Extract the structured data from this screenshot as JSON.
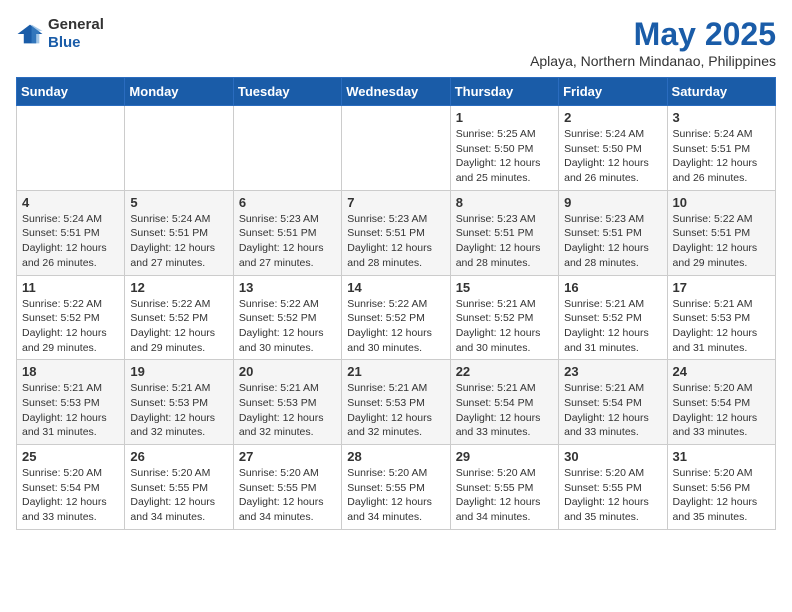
{
  "logo": {
    "general": "General",
    "blue": "Blue"
  },
  "title": "May 2025",
  "subtitle": "Aplaya, Northern Mindanao, Philippines",
  "weekdays": [
    "Sunday",
    "Monday",
    "Tuesday",
    "Wednesday",
    "Thursday",
    "Friday",
    "Saturday"
  ],
  "weeks": [
    [
      {
        "day": "",
        "info": ""
      },
      {
        "day": "",
        "info": ""
      },
      {
        "day": "",
        "info": ""
      },
      {
        "day": "",
        "info": ""
      },
      {
        "day": "1",
        "info": "Sunrise: 5:25 AM\nSunset: 5:50 PM\nDaylight: 12 hours and 25 minutes."
      },
      {
        "day": "2",
        "info": "Sunrise: 5:24 AM\nSunset: 5:50 PM\nDaylight: 12 hours and 26 minutes."
      },
      {
        "day": "3",
        "info": "Sunrise: 5:24 AM\nSunset: 5:51 PM\nDaylight: 12 hours and 26 minutes."
      }
    ],
    [
      {
        "day": "4",
        "info": "Sunrise: 5:24 AM\nSunset: 5:51 PM\nDaylight: 12 hours and 26 minutes."
      },
      {
        "day": "5",
        "info": "Sunrise: 5:24 AM\nSunset: 5:51 PM\nDaylight: 12 hours and 27 minutes."
      },
      {
        "day": "6",
        "info": "Sunrise: 5:23 AM\nSunset: 5:51 PM\nDaylight: 12 hours and 27 minutes."
      },
      {
        "day": "7",
        "info": "Sunrise: 5:23 AM\nSunset: 5:51 PM\nDaylight: 12 hours and 28 minutes."
      },
      {
        "day": "8",
        "info": "Sunrise: 5:23 AM\nSunset: 5:51 PM\nDaylight: 12 hours and 28 minutes."
      },
      {
        "day": "9",
        "info": "Sunrise: 5:23 AM\nSunset: 5:51 PM\nDaylight: 12 hours and 28 minutes."
      },
      {
        "day": "10",
        "info": "Sunrise: 5:22 AM\nSunset: 5:51 PM\nDaylight: 12 hours and 29 minutes."
      }
    ],
    [
      {
        "day": "11",
        "info": "Sunrise: 5:22 AM\nSunset: 5:52 PM\nDaylight: 12 hours and 29 minutes."
      },
      {
        "day": "12",
        "info": "Sunrise: 5:22 AM\nSunset: 5:52 PM\nDaylight: 12 hours and 29 minutes."
      },
      {
        "day": "13",
        "info": "Sunrise: 5:22 AM\nSunset: 5:52 PM\nDaylight: 12 hours and 30 minutes."
      },
      {
        "day": "14",
        "info": "Sunrise: 5:22 AM\nSunset: 5:52 PM\nDaylight: 12 hours and 30 minutes."
      },
      {
        "day": "15",
        "info": "Sunrise: 5:21 AM\nSunset: 5:52 PM\nDaylight: 12 hours and 30 minutes."
      },
      {
        "day": "16",
        "info": "Sunrise: 5:21 AM\nSunset: 5:52 PM\nDaylight: 12 hours and 31 minutes."
      },
      {
        "day": "17",
        "info": "Sunrise: 5:21 AM\nSunset: 5:53 PM\nDaylight: 12 hours and 31 minutes."
      }
    ],
    [
      {
        "day": "18",
        "info": "Sunrise: 5:21 AM\nSunset: 5:53 PM\nDaylight: 12 hours and 31 minutes."
      },
      {
        "day": "19",
        "info": "Sunrise: 5:21 AM\nSunset: 5:53 PM\nDaylight: 12 hours and 32 minutes."
      },
      {
        "day": "20",
        "info": "Sunrise: 5:21 AM\nSunset: 5:53 PM\nDaylight: 12 hours and 32 minutes."
      },
      {
        "day": "21",
        "info": "Sunrise: 5:21 AM\nSunset: 5:53 PM\nDaylight: 12 hours and 32 minutes."
      },
      {
        "day": "22",
        "info": "Sunrise: 5:21 AM\nSunset: 5:54 PM\nDaylight: 12 hours and 33 minutes."
      },
      {
        "day": "23",
        "info": "Sunrise: 5:21 AM\nSunset: 5:54 PM\nDaylight: 12 hours and 33 minutes."
      },
      {
        "day": "24",
        "info": "Sunrise: 5:20 AM\nSunset: 5:54 PM\nDaylight: 12 hours and 33 minutes."
      }
    ],
    [
      {
        "day": "25",
        "info": "Sunrise: 5:20 AM\nSunset: 5:54 PM\nDaylight: 12 hours and 33 minutes."
      },
      {
        "day": "26",
        "info": "Sunrise: 5:20 AM\nSunset: 5:55 PM\nDaylight: 12 hours and 34 minutes."
      },
      {
        "day": "27",
        "info": "Sunrise: 5:20 AM\nSunset: 5:55 PM\nDaylight: 12 hours and 34 minutes."
      },
      {
        "day": "28",
        "info": "Sunrise: 5:20 AM\nSunset: 5:55 PM\nDaylight: 12 hours and 34 minutes."
      },
      {
        "day": "29",
        "info": "Sunrise: 5:20 AM\nSunset: 5:55 PM\nDaylight: 12 hours and 34 minutes."
      },
      {
        "day": "30",
        "info": "Sunrise: 5:20 AM\nSunset: 5:55 PM\nDaylight: 12 hours and 35 minutes."
      },
      {
        "day": "31",
        "info": "Sunrise: 5:20 AM\nSunset: 5:56 PM\nDaylight: 12 hours and 35 minutes."
      }
    ]
  ]
}
